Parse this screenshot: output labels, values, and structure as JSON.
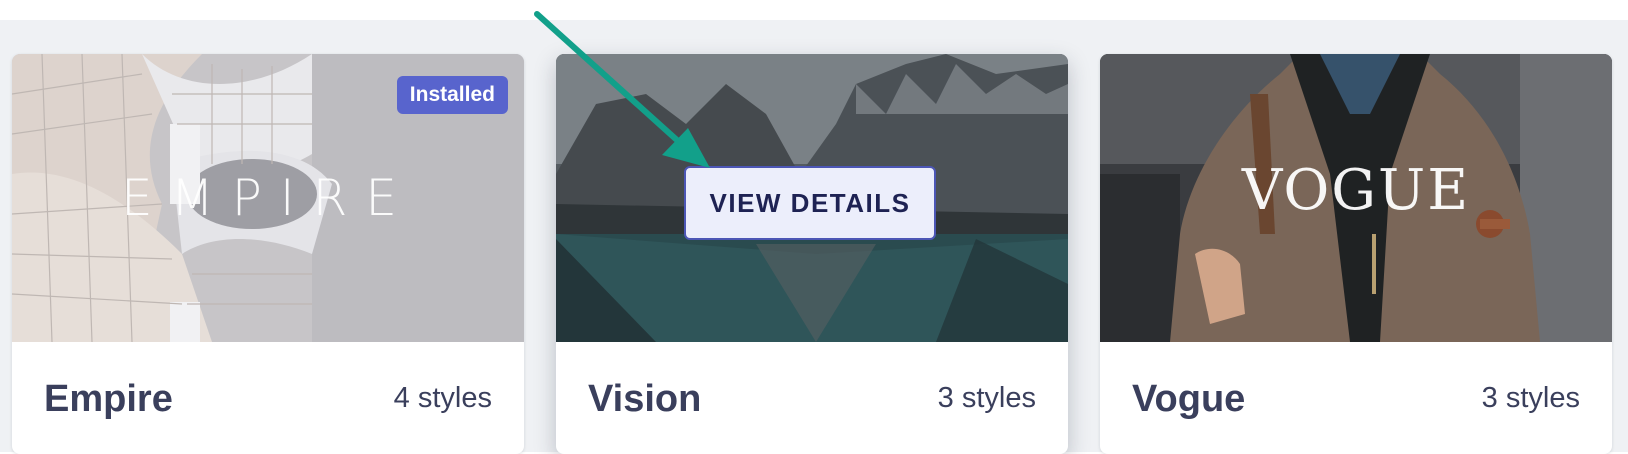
{
  "themes": [
    {
      "name": "Empire",
      "styles": "4 styles",
      "thumbnail_title": "EMPIRE",
      "badge": "Installed"
    },
    {
      "name": "Vision",
      "styles": "3 styles",
      "hover_button": "VIEW DETAILS"
    },
    {
      "name": "Vogue",
      "styles": "3 styles",
      "thumbnail_title": "VOGUE"
    }
  ],
  "colors": {
    "badge": "#5864cd",
    "button_border": "#4c56b5",
    "button_text": "#1e2253",
    "arrow": "#12a08a",
    "text": "#3a3f5c"
  },
  "icons": {
    "annotation": "arrow-pointer-icon"
  }
}
